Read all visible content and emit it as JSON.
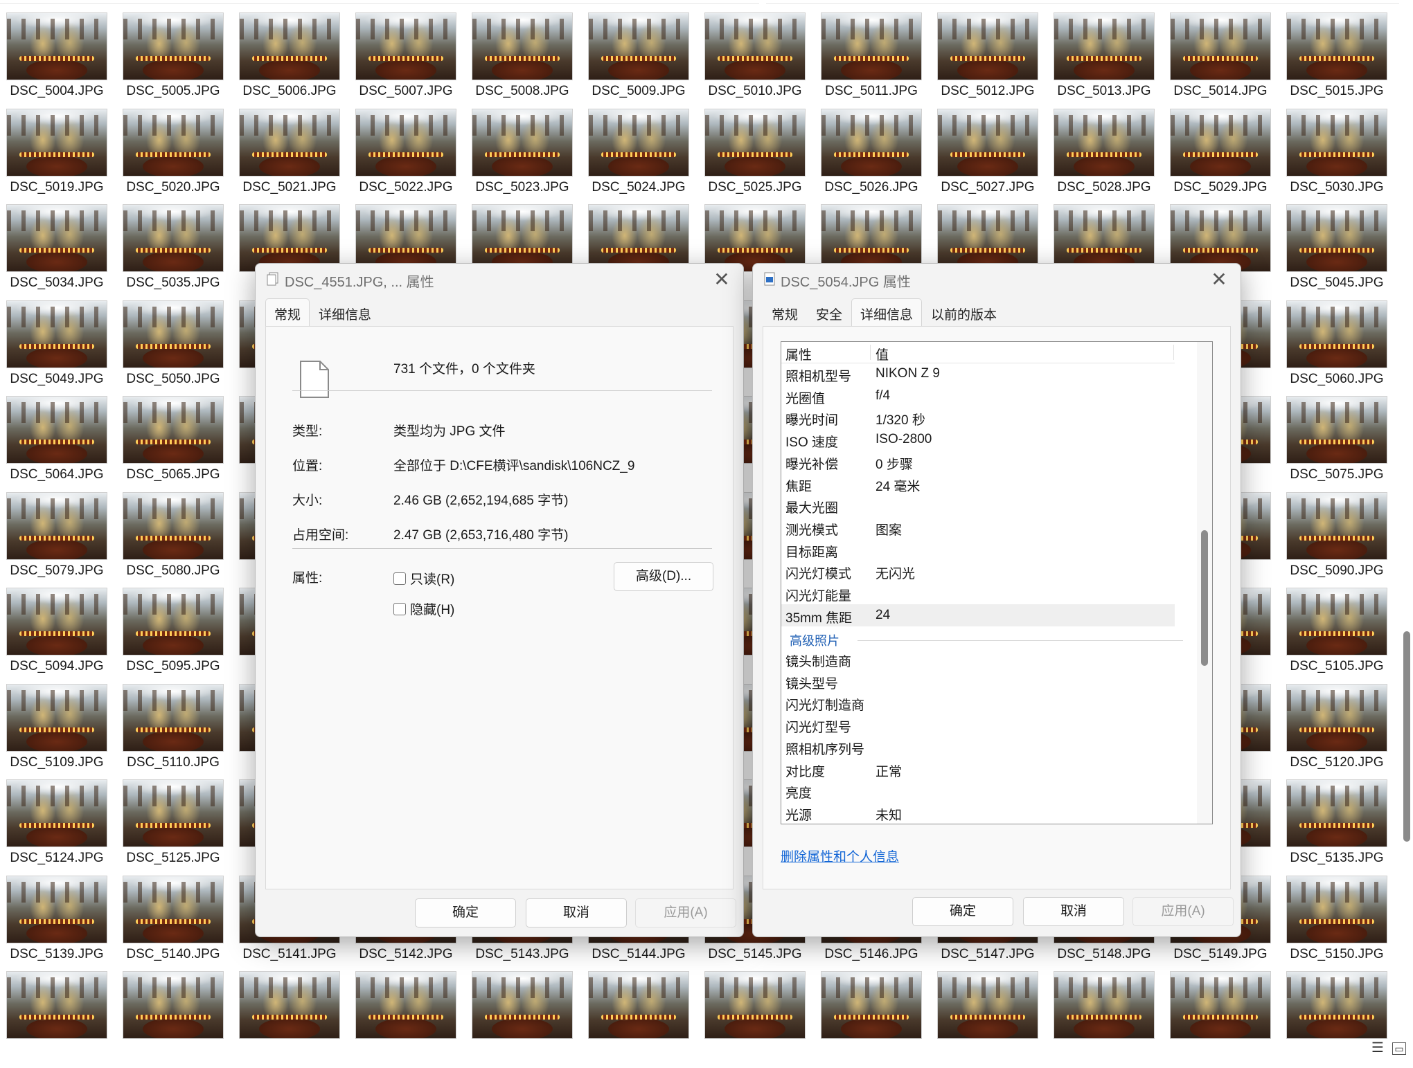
{
  "explorer": {
    "files": [
      "DSC_5004.JPG",
      "DSC_5005.JPG",
      "DSC_5006.JPG",
      "DSC_5007.JPG",
      "DSC_5008.JPG",
      "DSC_5009.JPG",
      "DSC_5010.JPG",
      "DSC_5011.JPG",
      "DSC_5012.JPG",
      "DSC_5013.JPG",
      "DSC_5014.JPG",
      "DSC_5015.JPG",
      "DSC_5019.JPG",
      "DSC_5020.JPG",
      "DSC_5021.JPG",
      "DSC_5022.JPG",
      "DSC_5023.JPG",
      "DSC_5024.JPG",
      "DSC_5025.JPG",
      "DSC_5026.JPG",
      "DSC_5027.JPG",
      "DSC_5028.JPG",
      "DSC_5029.JPG",
      "DSC_5030.JPG",
      "DSC_5034.JPG",
      "DSC_5035.JPG",
      "",
      "",
      "",
      "",
      "",
      "",
      "",
      "",
      "",
      "DSC_5045.JPG",
      "DSC_5049.JPG",
      "DSC_5050.JPG",
      "",
      "",
      "",
      "",
      "",
      "",
      "",
      "",
      "",
      "DSC_5060.JPG",
      "DSC_5064.JPG",
      "DSC_5065.JPG",
      "",
      "",
      "",
      "",
      "",
      "",
      "",
      "",
      "",
      "DSC_5075.JPG",
      "DSC_5079.JPG",
      "DSC_5080.JPG",
      "",
      "",
      "",
      "",
      "",
      "",
      "",
      "",
      "",
      "DSC_5090.JPG",
      "DSC_5094.JPG",
      "DSC_5095.JPG",
      "",
      "",
      "",
      "",
      "",
      "",
      "",
      "",
      "",
      "DSC_5105.JPG",
      "DSC_5109.JPG",
      "DSC_5110.JPG",
      "",
      "",
      "",
      "",
      "",
      "",
      "",
      "",
      "",
      "DSC_5120.JPG",
      "DSC_5124.JPG",
      "DSC_5125.JPG",
      "",
      "",
      "",
      "",
      "",
      "",
      "",
      "",
      "",
      "DSC_5135.JPG",
      "DSC_5139.JPG",
      "DSC_5140.JPG",
      "DSC_5141.JPG",
      "DSC_5142.JPG",
      "DSC_5143.JPG",
      "DSC_5144.JPG",
      "DSC_5145.JPG",
      "DSC_5146.JPG",
      "DSC_5147.JPG",
      "DSC_5148.JPG",
      "DSC_5149.JPG",
      "DSC_5150.JPG",
      "",
      "",
      "",
      "",
      "",
      "",
      "",
      "",
      "",
      "",
      "",
      ""
    ],
    "status_icons": [
      "details-view-icon",
      "large-icons-view-icon"
    ]
  },
  "dialog_multi": {
    "title": "DSC_4551.JPG, ... 属性",
    "tabs": [
      "常规",
      "详细信息"
    ],
    "summary": "731 个文件，0 个文件夹",
    "rows": [
      {
        "label": "类型:",
        "value": "类型均为 JPG 文件"
      },
      {
        "label": "位置:",
        "value": "全部位于 D:\\CFE横评\\sandisk\\106NCZ_9"
      },
      {
        "label": "大小:",
        "value": "2.46 GB (2,652,194,685 字节)"
      },
      {
        "label": "占用空间:",
        "value": "2.47 GB (2,653,716,480 字节)"
      }
    ],
    "attributes_label": "属性:",
    "readonly_label": "只读(R)",
    "hidden_label": "隐藏(H)",
    "advanced_label": "高级(D)...",
    "ok": "确定",
    "cancel": "取消",
    "apply": "应用(A)"
  },
  "dialog_single": {
    "title": "DSC_5054.JPG 属性",
    "tabs": [
      "常规",
      "安全",
      "详细信息",
      "以前的版本"
    ],
    "header_property": "属性",
    "header_value": "值",
    "rows": [
      {
        "k": "照相机型号",
        "v": "NIKON Z 9"
      },
      {
        "k": "光圈值",
        "v": "f/4"
      },
      {
        "k": "曝光时间",
        "v": "1/320 秒"
      },
      {
        "k": "ISO 速度",
        "v": "ISO-2800"
      },
      {
        "k": "曝光补偿",
        "v": "0 步骤"
      },
      {
        "k": "焦距",
        "v": "24 毫米"
      },
      {
        "k": "最大光圈",
        "v": ""
      },
      {
        "k": "测光模式",
        "v": "图案"
      },
      {
        "k": "目标距离",
        "v": ""
      },
      {
        "k": "闪光灯模式",
        "v": "无闪光"
      },
      {
        "k": "闪光灯能量",
        "v": ""
      },
      {
        "k": "35mm 焦距",
        "v": "24"
      }
    ],
    "group": "高级照片",
    "rows2": [
      {
        "k": "镜头制造商",
        "v": ""
      },
      {
        "k": "镜头型号",
        "v": ""
      },
      {
        "k": "闪光灯制造商",
        "v": ""
      },
      {
        "k": "闪光灯型号",
        "v": ""
      },
      {
        "k": "照相机序列号",
        "v": ""
      },
      {
        "k": "对比度",
        "v": "正常"
      },
      {
        "k": "亮度",
        "v": ""
      },
      {
        "k": "光源",
        "v": "未知"
      }
    ],
    "remove_link": "删除属性和个人信息",
    "ok": "确定",
    "cancel": "取消",
    "apply": "应用(A)"
  }
}
